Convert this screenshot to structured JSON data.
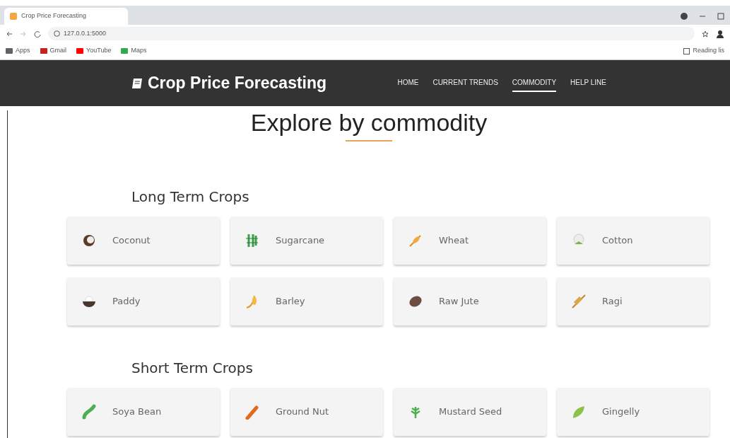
{
  "browser": {
    "tab_title": "Crop Price Forecasting",
    "url": "127.0.0.1:5000",
    "bookmarks": [
      "Apps",
      "Gmail",
      "YouTube",
      "Maps"
    ],
    "reading_list": "Reading lis"
  },
  "navbar": {
    "brand": "Crop Price Forecasting",
    "links": [
      {
        "label": "HOME",
        "selected": false
      },
      {
        "label": "CURRENT TRENDS",
        "selected": false
      },
      {
        "label": "COMMODITY",
        "selected": true
      },
      {
        "label": "HELP LINE",
        "selected": false
      }
    ]
  },
  "page_title": "Explore by commodity",
  "sections": [
    {
      "title": "Long Term Crops",
      "crops": [
        "Coconut",
        "Sugarcane",
        "Wheat",
        "Cotton",
        "Paddy",
        "Barley",
        "Raw Jute",
        "Ragi"
      ]
    },
    {
      "title": "Short Term Crops",
      "crops": [
        "Soya Bean",
        "Ground Nut",
        "Mustard Seed",
        "Gingelly"
      ]
    }
  ]
}
